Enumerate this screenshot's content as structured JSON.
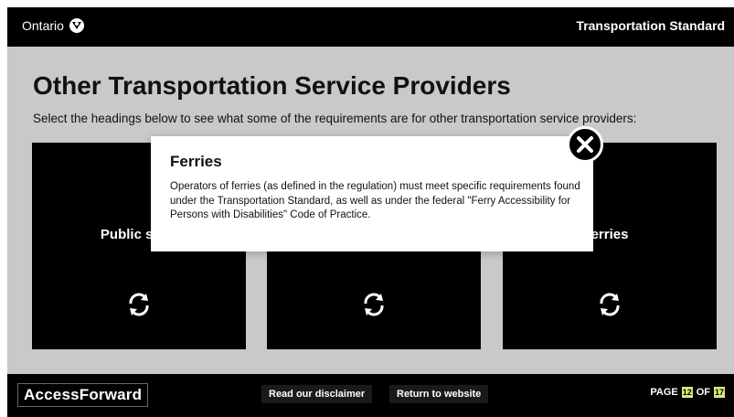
{
  "header": {
    "brand": "Ontario",
    "section_title": "Transportation Standard"
  },
  "main": {
    "title": "Other Transportation Service Providers",
    "subtitle": "Select the headings below to see what some of the requirements are for other transportation service providers:",
    "cards": [
      {
        "label": "Public scho",
        "icon": "refresh-icon"
      },
      {
        "label": "",
        "icon": "refresh-icon"
      },
      {
        "label": "erries",
        "icon": "refresh-icon"
      }
    ]
  },
  "modal": {
    "title": "Ferries",
    "body": "Operators of ferries (as defined in the regulation) must meet specific requirements found under the Transportation Standard, as well as under the federal \"Ferry Accessibility for Persons with Disabilities\" Code of Practice.",
    "close_icon": "close-icon"
  },
  "footer": {
    "logo": "AccessForward",
    "disclaimer_label": "Read our disclaimer",
    "return_label": "Return to website",
    "page_prefix": "PAGE",
    "page_current": "12",
    "page_of": "OF",
    "page_total": "17"
  },
  "colors": {
    "topbar": "#000000",
    "content_bg": "#c9c9c9",
    "card_bg": "#000000",
    "page_box": "#d7ec7a"
  }
}
